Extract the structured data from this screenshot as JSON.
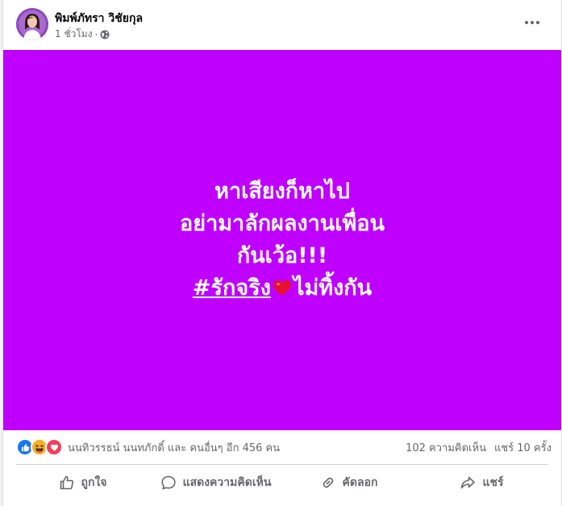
{
  "post": {
    "author": "พิมพ์ภัทรา วิชัยกุล",
    "time": "1 ชั่วโมง",
    "separator": "·",
    "audience_icon": "globe-icon",
    "more_icon": "more-options-icon"
  },
  "media": {
    "background_color": "#bf00ff",
    "line1": "หาเสียงก็หาไป",
    "line2": "อย่ามาลักผลงานเพื่อน",
    "line3": "กันเว้อ!!!",
    "hashtag": "#รักจริง",
    "heart_icon": "red-heart-emoji",
    "line4_rest": "ไม่ทิ้งกัน"
  },
  "stats": {
    "reaction_icons": [
      "like-icon",
      "haha-icon",
      "love-icon"
    ],
    "reactions_text": "นนทิวรรธน์ นนทภักดิ์ และ คนอื่นๆ อีก 456 คน",
    "comments": "102 ความคิดเห็น",
    "shares": "แชร์ 10 ครั้ง"
  },
  "actions": {
    "like": "ถูกใจ",
    "comment": "แสดงความคิดเห็น",
    "copy": "คัดลอก",
    "share": "แชร์"
  },
  "colors": {
    "like_blue": "#1877f2",
    "love_red": "#f33e58",
    "haha_yellow": "#f7b125",
    "secondary_text": "#65676b"
  }
}
